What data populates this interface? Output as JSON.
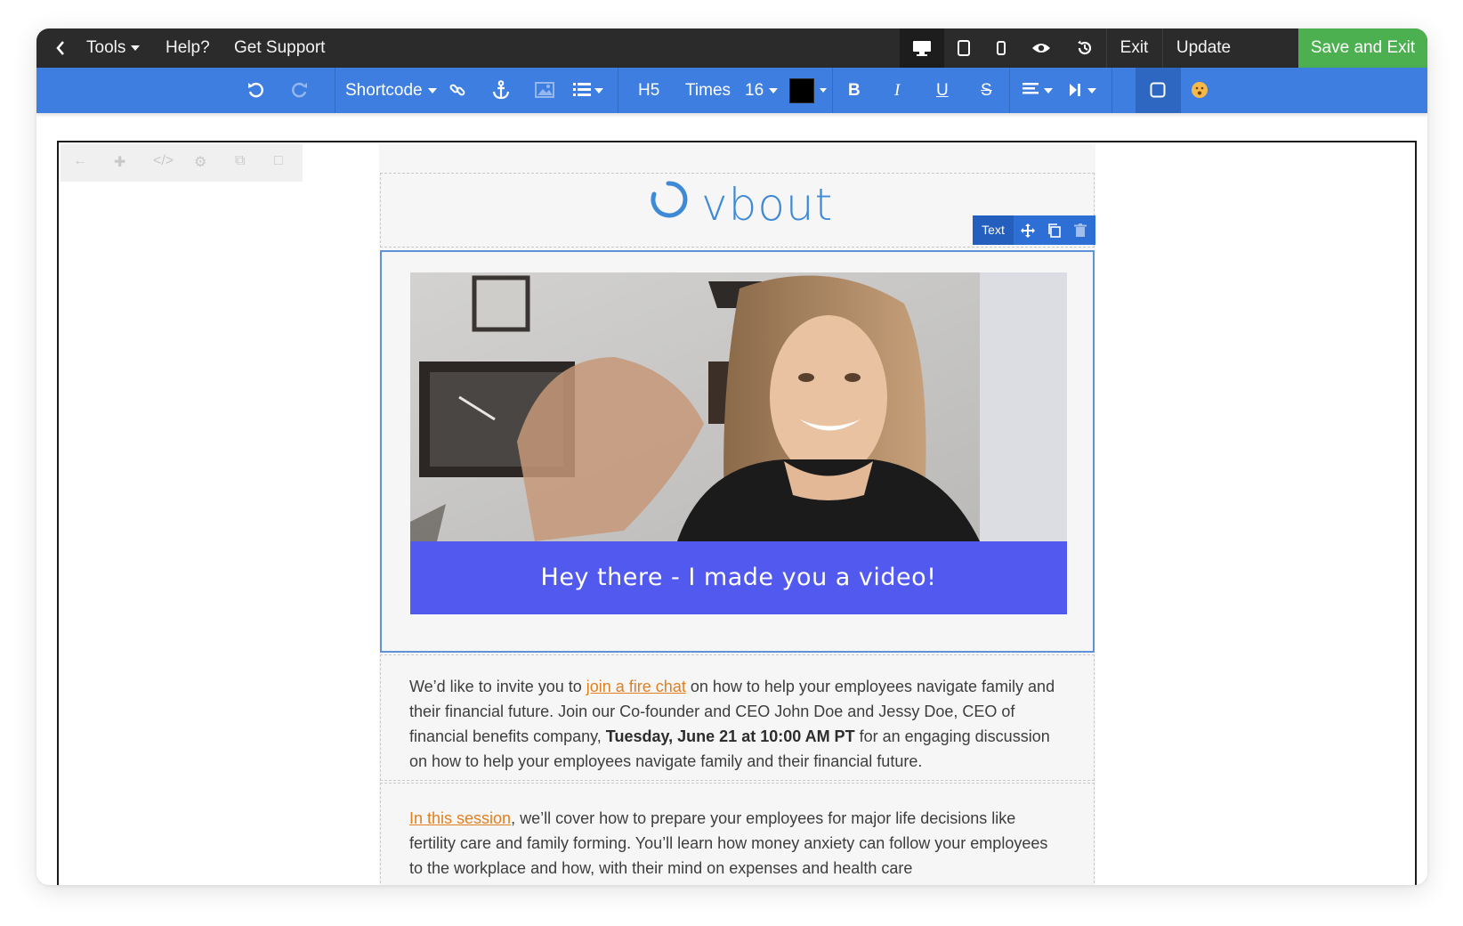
{
  "topbar": {
    "back_icon": "chevron-left-icon",
    "tools_label": "Tools",
    "help_label": "Help?",
    "support_label": "Get Support",
    "devices": [
      "desktop-icon",
      "tablet-icon",
      "mobile-icon"
    ],
    "preview_icon": "eye-icon",
    "history_icon": "history-icon",
    "exit_label": "Exit",
    "update_label": "Update",
    "save_exit_label": "Save and Exit"
  },
  "toolbar": {
    "shortcode_label": "Shortcode",
    "heading_label": "H5",
    "font_label": "Times",
    "size_label": "16",
    "text_color": "#000000",
    "bold_label": "B",
    "italic_label": "I",
    "underline_label": "U",
    "strike_label": "S"
  },
  "canvas": {
    "logo_text": "vbout",
    "block_tool_label": "Text",
    "video_banner_text": "Hey there - I made you a video!",
    "para1": {
      "before_link": "We’d like to invite you to ",
      "link": "join a fire chat",
      "after_link": " on how to help your employees navigate family and their financial future. Join our Co-founder and CEO John Doe and Jessy Doe, CEO of financial benefits company, ",
      "bold": "Tuesday, June 21 at 10:00 AM PT",
      "after_bold": " for an engaging discussion on how to help your employees navigate family and their financial future."
    },
    "para2": {
      "link": "In this session",
      "after_link": ", we’ll cover how to prepare your employees for major life decisions like fertility care and family forming. You’ll learn how money anxiety can follow your employees to the workplace and how, with their mind on expenses and health care"
    }
  },
  "colors": {
    "topbar_bg": "#2b2b2b",
    "toolbar_bg": "#3d7ee0",
    "save_button": "#4caf50",
    "banner": "#5159ef",
    "link": "#e07f1e",
    "logo": "#3f8ad6"
  }
}
